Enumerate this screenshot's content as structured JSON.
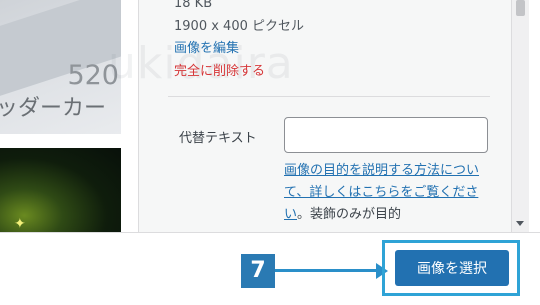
{
  "media_grid": {
    "thumb1_number": "520",
    "thumb1_caption": "ッダーカー"
  },
  "attachment_details": {
    "file_size": "18 KB",
    "dimensions": "1900 x 400 ピクセル",
    "edit_link": "画像を編集",
    "delete_link": "完全に削除する",
    "alt_text_label": "代替テキスト",
    "alt_text_value": "",
    "help_link": "画像の目的を説明する方法について、詳しくはこちらをご覧ください",
    "help_rest": "。装飾のみが目的"
  },
  "watermark": "ukidaira",
  "annotation": {
    "step_number": "7"
  },
  "toolbar": {
    "select_button_label": "画像を選択"
  },
  "colors": {
    "primary_button": "#2271b1",
    "link": "#2271b1",
    "delete": "#d63638",
    "annotation": "#2a7ab3",
    "highlight": "#2fa3d6"
  }
}
